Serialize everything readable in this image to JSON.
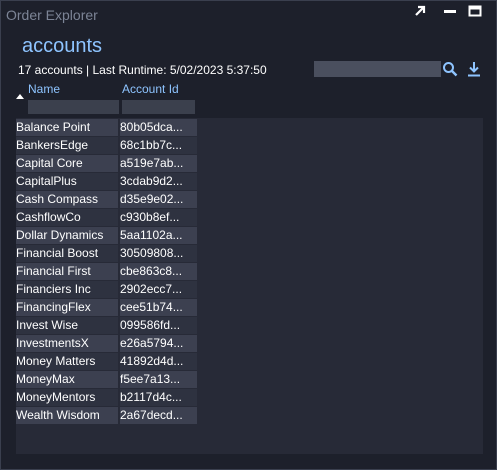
{
  "window": {
    "title": "Order Explorer",
    "controls": [
      "popout-icon",
      "minimize-icon",
      "maximize-icon"
    ]
  },
  "header": {
    "title": "accounts",
    "summary": "17 accounts | Last Runtime: 5/02/2023 5:37:50",
    "search_value": "",
    "search_icon": "search-icon",
    "download_icon": "download-icon"
  },
  "table": {
    "columns": [
      "Name",
      "Account Id"
    ],
    "sort": "ascending",
    "rows": [
      {
        "name": "Balance Point",
        "id": "80b05dca..."
      },
      {
        "name": "BankersEdge",
        "id": "68c1bb7c..."
      },
      {
        "name": "Capital Core",
        "id": "a519e7ab..."
      },
      {
        "name": "CapitalPlus",
        "id": "3cdab9d2..."
      },
      {
        "name": "Cash Compass",
        "id": "d35e9e02..."
      },
      {
        "name": "CashflowCo",
        "id": "c930b8ef..."
      },
      {
        "name": "Dollar Dynamics",
        "id": "5aa1102a..."
      },
      {
        "name": "Financial Boost",
        "id": "30509808..."
      },
      {
        "name": "Financial First",
        "id": "cbe863c8..."
      },
      {
        "name": "Financiers Inc",
        "id": "2902ecc7..."
      },
      {
        "name": "FinancingFlex",
        "id": "cee51b74..."
      },
      {
        "name": "Invest Wise",
        "id": "099586fd..."
      },
      {
        "name": "InvestmentsX",
        "id": "e26a5794..."
      },
      {
        "name": "Money Matters",
        "id": "41892d4d..."
      },
      {
        "name": "MoneyMax",
        "id": "f5ee7a13..."
      },
      {
        "name": "MoneyMentors",
        "id": "b2117d4c..."
      },
      {
        "name": "Wealth Wisdom",
        "id": "2a67decd..."
      }
    ]
  },
  "colors": {
    "accent": "#8ec4ff",
    "background": "#1d202b",
    "row_odd": "#3c4050",
    "row_even": "#2e3240"
  }
}
